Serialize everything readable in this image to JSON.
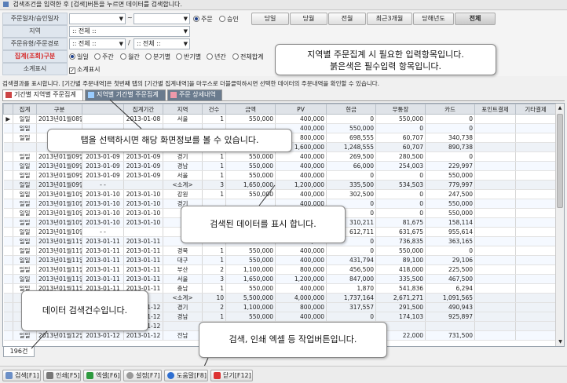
{
  "topbar": {
    "text": "검색조건을 입력한 후 [검색]버튼을 누르면 데이터를 검색합니다."
  },
  "search": {
    "date_label": "주문일자/승인일자",
    "date_sep": "~",
    "date_type": [
      "주문",
      "승인"
    ],
    "range_buttons": [
      "당일",
      "당월",
      "전월",
      "최근3개월",
      "당해년도",
      "전체"
    ],
    "region_label": "지역",
    "region_value": ":: 전체 ::",
    "channel_label": "주문유형/주문경로",
    "channel_value1": ":: 전체 ::",
    "channel_sep": "/",
    "channel_value2": ":: 전체 ::",
    "agg_label": "집계(조회)구분",
    "agg_options": [
      "일일",
      "주간",
      "월간",
      "분기별",
      "반기별",
      "년간",
      "전체합계"
    ],
    "subtotal_label": "소계표시",
    "subtotal_check": "소계표시"
  },
  "callouts": {
    "c1_line1": "지역별 주문집계 시 필요한 입력항목입니다.",
    "c1_line2": "붉은색은 필수입력 항목입니다.",
    "c2": "탭을 선택하시면 해당 화면정보를 볼 수 있습니다.",
    "c3": "검색된 데이터를 표시 합니다.",
    "c4": "데이터 검색건수입니다.",
    "c5": "검색, 인쇄 엑셀 등 작업버튼입니다."
  },
  "info_text": "검색결과를 표시합니다. [기간별 주문내역]은 첫번째 탭의 [기간별 집계내역]을 마우스로 더블클릭하시면 선택한 데이터의 주문내역을 확인할 수 있습니다.",
  "tabs": [
    "기간별 지역별 주문집계",
    "지역별 기간별 주문집계",
    "주문 상세내역"
  ],
  "table": {
    "headers": [
      "집계",
      "구분",
      "",
      "집계기간",
      "지역",
      "건수",
      "금액",
      "PV",
      "현금",
      "무통장",
      "카드",
      "포인트결제",
      "기타결제"
    ],
    "rows": [
      [
        "일일",
        "2013년01월08일",
        "",
        "2013-01-08",
        "서울",
        "1",
        "550,000",
        "400,000",
        "0",
        "550,000",
        "0",
        "",
        ""
      ],
      [
        "일일",
        "",
        "",
        "",
        "",
        "",
        "",
        "400,000",
        "550,000",
        "0",
        "0",
        "",
        ""
      ],
      [
        "일일",
        "",
        "",
        "",
        "",
        "",
        "",
        "800,000",
        "698,555",
        "60,707",
        "340,738",
        "",
        ""
      ],
      [
        "",
        "",
        "",
        "",
        "",
        "",
        "",
        "1,600,000",
        "1,248,555",
        "60,707",
        "890,738",
        "",
        ""
      ],
      [
        "일일",
        "2013년01월09일",
        "2013-01-09",
        "2013-01-09",
        "경기",
        "1",
        "550,000",
        "400,000",
        "269,500",
        "280,500",
        "0",
        "",
        ""
      ],
      [
        "일일",
        "2013년01월09일",
        "2013-01-09",
        "2013-01-09",
        "경남",
        "1",
        "550,000",
        "400,000",
        "66,000",
        "254,003",
        "229,997",
        "",
        ""
      ],
      [
        "일일",
        "2013년01월09일",
        "2013-01-09",
        "2013-01-09",
        "서울",
        "1",
        "550,000",
        "400,000",
        "0",
        "0",
        "550,000",
        "",
        ""
      ],
      [
        "일일",
        "2013년01월09일",
        "- -",
        "",
        "<소계>",
        "3",
        "1,650,000",
        "1,200,000",
        "335,500",
        "534,503",
        "779,997",
        "",
        ""
      ],
      [
        "일일",
        "2013년01월10일",
        "2013-01-10",
        "2013-01-10",
        "강원",
        "1",
        "550,000",
        "400,000",
        "302,500",
        "0",
        "247,500",
        "",
        ""
      ],
      [
        "일일",
        "2013년01월10일",
        "2013-01-10",
        "2013-01-10",
        "경기",
        "",
        "",
        "400,000",
        "0",
        "0",
        "550,000",
        "",
        ""
      ],
      [
        "일일",
        "2013년01월10일",
        "2013-01-10",
        "2013-01-10",
        "",
        "",
        "",
        "400,000",
        "0",
        "0",
        "550,000",
        "",
        ""
      ],
      [
        "일일",
        "2013년01월10일",
        "2013-01-10",
        "2013-01-10",
        "",
        "",
        "",
        "400,000",
        "310,211",
        "81,675",
        "158,114",
        "",
        ""
      ],
      [
        "일일",
        "2013년01월10일",
        "- -",
        "",
        "",
        "",
        "",
        "2,000,000",
        "612,711",
        "631,675",
        "955,614",
        "",
        ""
      ],
      [
        "일일",
        "2013년01월11일",
        "2013-01-11",
        "2013-01-11",
        "",
        "",
        "",
        "400,000",
        "0",
        "736,835",
        "363,165",
        "",
        ""
      ],
      [
        "일일",
        "2013년01월11일",
        "2013-01-11",
        "2013-01-11",
        "경북",
        "1",
        "550,000",
        "400,000",
        "0",
        "550,000",
        "0",
        "",
        ""
      ],
      [
        "일일",
        "2013년01월11일",
        "2013-01-11",
        "2013-01-11",
        "대구",
        "1",
        "550,000",
        "400,000",
        "431,794",
        "89,100",
        "29,106",
        "",
        ""
      ],
      [
        "일일",
        "2013년01월11일",
        "2013-01-11",
        "2013-01-11",
        "부산",
        "2",
        "1,100,000",
        "800,000",
        "456,500",
        "418,000",
        "225,500",
        "",
        ""
      ],
      [
        "일일",
        "2013년01월11일",
        "2013-01-11",
        "2013-01-11",
        "서울",
        "3",
        "1,650,000",
        "1,200,000",
        "847,000",
        "335,500",
        "467,500",
        "",
        ""
      ],
      [
        "일일",
        "2013년01월11일",
        "2013-01-11",
        "2013-01-11",
        "충남",
        "1",
        "550,000",
        "400,000",
        "1,870",
        "541,836",
        "6,294",
        "",
        ""
      ],
      [
        "",
        "",
        "",
        "",
        "<소계>",
        "10",
        "5,500,000",
        "4,000,000",
        "1,737,164",
        "2,671,271",
        "1,091,565",
        "",
        ""
      ],
      [
        "",
        "",
        "",
        "2013-01-12",
        "경기",
        "2",
        "1,100,000",
        "800,000",
        "317,557",
        "291,500",
        "490,943",
        "",
        ""
      ],
      [
        "",
        "",
        "",
        "2013-01-12",
        "경남",
        "1",
        "550,000",
        "400,000",
        "0",
        "174,103",
        "925,897",
        "",
        ""
      ],
      [
        "",
        "",
        "",
        "2013-01-12",
        "",
        "",
        "",
        "",
        "",
        "",
        "",
        "",
        ""
      ],
      [
        "일일",
        "2013년01월12일",
        "2013-01-12",
        "2013-01-12",
        "전남",
        "1",
        "550,000",
        "400,000",
        "",
        "22,000",
        "731,500",
        "",
        ""
      ]
    ]
  },
  "row_count": "196건",
  "bottom_buttons": [
    "검색[F1]",
    "인쇄[F5]",
    "엑셀[F6]",
    "설정[F7]",
    "도움말[F8]",
    "닫기[F12]"
  ],
  "colors": {
    "required": "#d62a2a",
    "header_bg": "#dfe3e8",
    "callout_border": "#888888"
  }
}
